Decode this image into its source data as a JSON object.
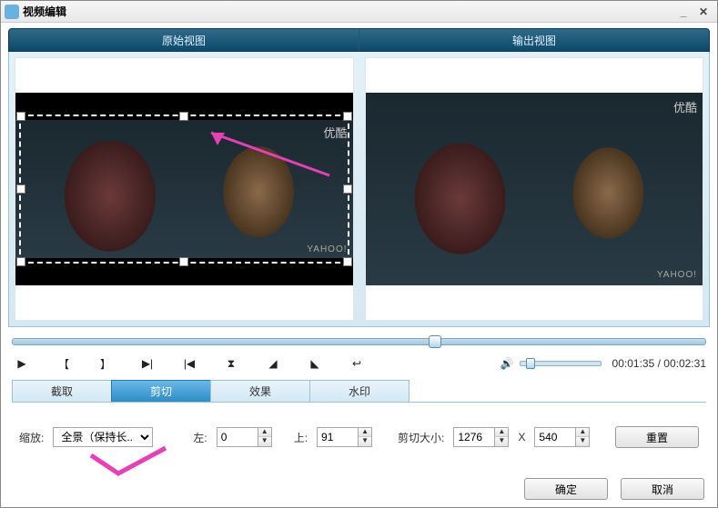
{
  "window": {
    "title": "视频编辑"
  },
  "header_tabs": {
    "original": "原始视图",
    "output": "输出视图"
  },
  "watermarks": {
    "site": "优酷",
    "logo": "YAHOO!"
  },
  "timecode": {
    "current": "00:01:35",
    "total": "00:02:31",
    "sep": " / "
  },
  "tabs": {
    "clip": "截取",
    "crop": "剪切",
    "effect": "效果",
    "watermark": "水印"
  },
  "form": {
    "zoom_label": "缩放:",
    "zoom_value": "全景（保持长...",
    "left_label": "左:",
    "left_value": "0",
    "top_label": "上:",
    "top_value": "91",
    "cropsize_label": "剪切大小:",
    "crop_w": "1276",
    "crop_x": "X",
    "crop_h": "540",
    "reset": "重置"
  },
  "footer": {
    "ok": "确定",
    "cancel": "取消"
  },
  "icons": {
    "play": "▶",
    "mark_in": "【",
    "mark_out": "】",
    "next": "▶|",
    "prev": "|◀",
    "hourglass": "⧗",
    "flag_a": "◢",
    "flag_b": "◣",
    "undo": "↩",
    "speaker": "🔊",
    "min": "_",
    "close": "✕",
    "up": "▲",
    "down": "▼"
  }
}
